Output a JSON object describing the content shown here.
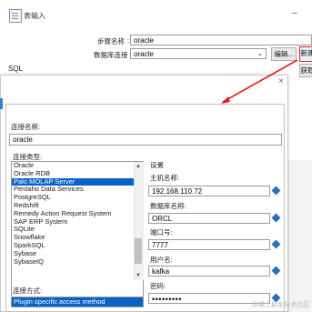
{
  "back_window": {
    "title": "表输入",
    "minimize": "–",
    "step_name_label": "步骤名称",
    "step_name_value": "oracle",
    "db_conn_label": "数据库连接",
    "db_conn_value": "oracle",
    "edit_button": "编辑...",
    "new_button": "新建",
    "fetch_button": "获取",
    "sql_label": "SQL"
  },
  "dialog": {
    "close": "×",
    "conn_name_label": "连接名称:",
    "conn_name_value": "oracle",
    "conn_type_label": "连接类型:",
    "conn_types": [
      "Oracle",
      "Oracle RDB",
      "Palo MOLAP Server",
      "Pentaho Data Services",
      "PostgreSQL",
      "Redshift",
      "Remedy Action Request System",
      "SAP ERP System",
      "SQLite",
      "Snowflake",
      "SparkSQL",
      "Sybase",
      "SybaseIQ"
    ],
    "selected_conn_type": "Palo MOLAP Server",
    "access_label": "连接方式:",
    "access_value": "Plugin specific access method",
    "settings_label": "设置",
    "host_label": "主机名称:",
    "host_value": "192.168.110.72",
    "dbname_label": "数据库名称:",
    "dbname_value": "ORCL",
    "port_label": "端口号:",
    "port_value": "7777",
    "user_label": "用户名:",
    "user_value": "kafka",
    "password_label": "密码:",
    "password_value": "•••••••••"
  },
  "watermark": "@稀土掘金技术社区",
  "colors": {
    "selection": "#0a62c9",
    "highlight": "#e02020",
    "field_icon": "#2a6fb8"
  }
}
